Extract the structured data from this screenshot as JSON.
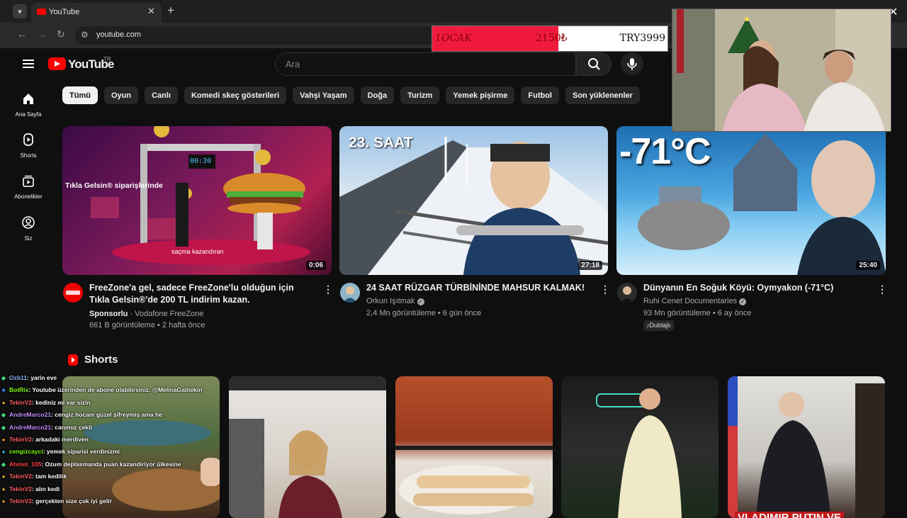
{
  "browser": {
    "tab_title": "YouTube",
    "url": "youtube.com",
    "icons": [
      "chevron-down-icon",
      "close-icon",
      "plus-icon",
      "back-icon",
      "forward-icon",
      "reload-icon",
      "site-settings-icon"
    ]
  },
  "donation_bar": {
    "left_text": "1OCAK",
    "mid_text": "2150₺",
    "right_text": "TRY3999",
    "progress_fraction": 0.537,
    "fill_color": "#ef1a3e"
  },
  "youtube": {
    "logo_text": "YouTube",
    "region": "TR",
    "search_placeholder": "Ara",
    "brand_color": "#ff0000"
  },
  "sidebar": {
    "items": [
      {
        "label": "Ana Sayfa",
        "icon": "home-icon"
      },
      {
        "label": "Shorts",
        "icon": "shorts-icon"
      },
      {
        "label": "Abonelikler",
        "icon": "subscriptions-icon"
      },
      {
        "label": "Siz",
        "icon": "user-icon"
      }
    ]
  },
  "chips": [
    "Tümü",
    "Oyun",
    "Canlı",
    "Komedi skeç gösterileri",
    "Vahşi Yaşam",
    "Doğa",
    "Turizm",
    "Yemek pişirme",
    "Futbol",
    "Son yüklenenler"
  ],
  "videos": [
    {
      "title": "FreeZone'a gel, sadece FreeZone'lu olduğun için Tıkla Gelsin®'de 200 TL indirim kazan.",
      "sponsored_label": "Sponsorlu",
      "channel": "Vodafone FreeZone",
      "meta": "661 B görüntüleme • 2 hafta önce",
      "duration": "0:06",
      "thumb_text_1": "Tıkla Gelsin® siparişlerinde",
      "thumb_text_2": "saçma kazandıran",
      "thumb_timer": "00:30"
    },
    {
      "title": "24 SAAT RÜZGAR TÜRBİNİNDE MAHSUR KALMAK!",
      "channel": "Orkun Işıtmak",
      "meta": "2,4 Mn görüntüleme • 6 gün önce",
      "duration": "27:18",
      "thumb_text": "23. SAAT"
    },
    {
      "title": "Dünyanın En Soğuk Köyü: Oymyakon (-71°C)",
      "channel": "Ruhi Cenet Documentaries",
      "meta": "93 Mn görüntüleme • 6 ay önce",
      "badge": "Dublajlı",
      "duration": "25:40",
      "thumb_text": "-71°C"
    }
  ],
  "shorts": {
    "title": "Shorts",
    "tile_texts": [
      "",
      "",
      "",
      "",
      "VLADIMIR PUTIN VE"
    ]
  },
  "chat": [
    {
      "user": "Ozb11",
      "msg": ": yarin eve",
      "color": "#8ab4f8",
      "badge": "diamond"
    },
    {
      "user": "BotRix",
      "msg": ": Youtube üzerinden de abone olabilirsiniz. @MelinaGalitekin",
      "color": "#7cfc00",
      "badge": "bot"
    },
    {
      "user": "TekinV2",
      "msg": ": kediniz mi var sizin",
      "color": "#ff5c5c",
      "badge": "coin"
    },
    {
      "user": "AndreMarco21",
      "msg": ": cengiz hocam güzel şifreymiş ama he",
      "color": "#c58af9",
      "badge": "diamond"
    },
    {
      "user": "AndreMarco21",
      "msg": ": canımız çekti",
      "color": "#c58af9",
      "badge": "diamond"
    },
    {
      "user": "TekinV2",
      "msg": ": arkadaki merdiven",
      "color": "#ff5c5c",
      "badge": "coin"
    },
    {
      "user": "cengizcayci",
      "msg": ": yemek siparisi verdinizmi",
      "color": "#7cfc00",
      "badge": "mod"
    },
    {
      "user": "Ahmet_105",
      "msg": ": Ozum deplasmanda puan kazandiriyor ülkesine",
      "color": "#ff3b3b",
      "badge": "diamond"
    },
    {
      "user": "TekinV2",
      "msg": ": tam kedilik",
      "color": "#ff5c5c",
      "badge": "coin"
    },
    {
      "user": "TekinV2",
      "msg": ": alın kedi",
      "color": "#ff5c5c",
      "badge": "coin"
    },
    {
      "user": "TekinV2",
      "msg": ": gerçekten size çok iyi gelir",
      "color": "#ff5c5c",
      "badge": "coin"
    }
  ]
}
